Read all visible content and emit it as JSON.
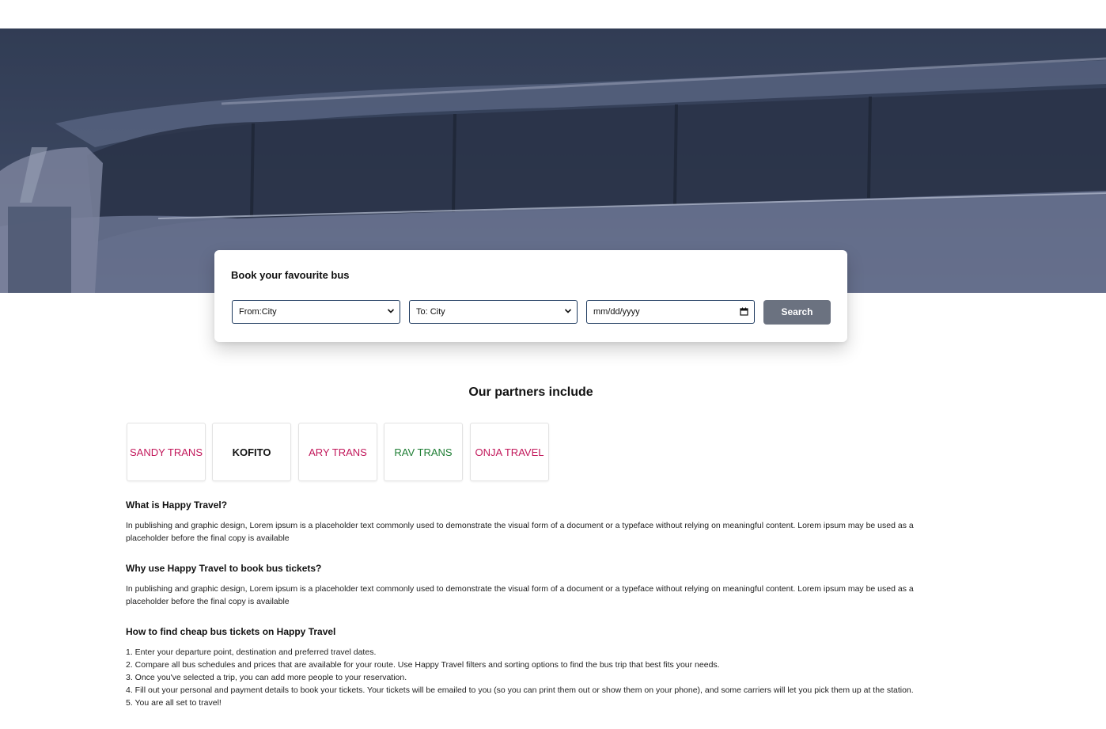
{
  "booking": {
    "title": "Book your favourite bus",
    "from_select": "From:City",
    "to_select": "To: City",
    "date_placeholder": "mm/dd/yyyy",
    "search_label": "Search"
  },
  "partners": {
    "title": "Our partners include",
    "items": [
      {
        "name": "SANDY TRANS",
        "color": "#c2185b"
      },
      {
        "name": "KOFITO",
        "color": "#111111"
      },
      {
        "name": "ARY TRANS",
        "color": "#c2185b"
      },
      {
        "name": "RAV TRANS",
        "color": "#1e7e34"
      },
      {
        "name": "ONJA TRAVEL",
        "color": "#c2185b"
      }
    ]
  },
  "sections": {
    "what": {
      "heading": "What is Happy Travel?",
      "body": "In publishing and graphic design, Lorem ipsum is a placeholder text commonly used to demonstrate the visual form of a document or a typeface without relying on meaningful content. Lorem ipsum may be used as a placeholder before the final copy is available"
    },
    "why": {
      "heading": "Why use Happy Travel to book bus tickets?",
      "body": "In publishing and graphic design, Lorem ipsum is a placeholder text commonly used to demonstrate the visual form of a document or a typeface without relying on meaningful content. Lorem ipsum may be used as a placeholder before the final copy is available"
    },
    "how": {
      "heading": "How to find cheap bus tickets on Happy Travel",
      "steps": [
        "1. Enter your departure point, destination and preferred travel dates.",
        "2. Compare all bus schedules and prices that are available for your route. Use Happy Travel filters and sorting options to find the bus trip that best fits your needs.",
        "3. Once you've selected a trip, you can add more people to your reservation.",
        "4. Fill out your personal and payment details to book your tickets. Your tickets will be emailed to you (so you can print them out or show them on your phone), and some carriers will let you pick them up at the station.",
        "5. You are all set to travel!"
      ]
    }
  }
}
